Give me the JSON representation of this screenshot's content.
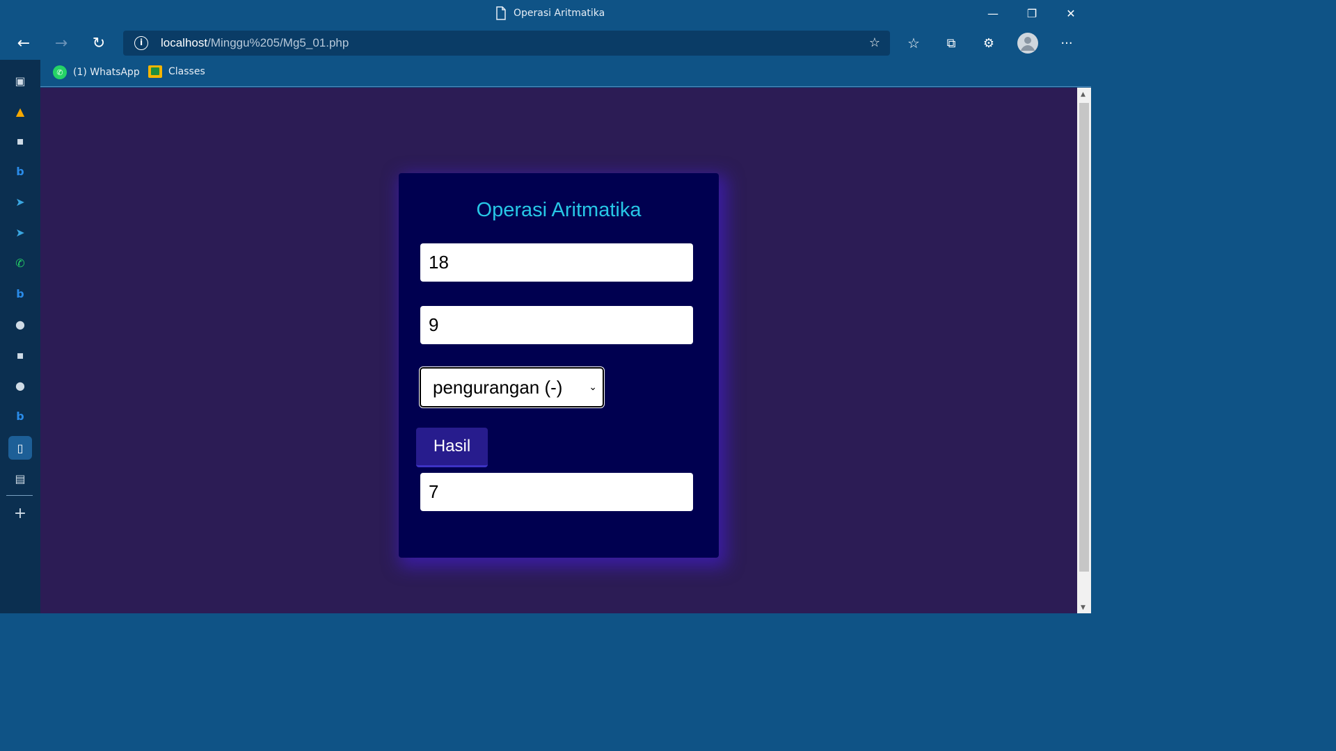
{
  "window": {
    "tab_title": "Operasi Aritmatika",
    "minimize": "—",
    "restore": "❐",
    "close": "✕"
  },
  "nav": {
    "back": "←",
    "forward": "→",
    "refresh": "↻",
    "info": "i",
    "url_host": "localhost",
    "url_path": "/Minggu%205/Mg5_01.php",
    "add_favorite": "☆",
    "favorites": "☆",
    "collections": "⧉",
    "extensions": "⚙",
    "menu": "···"
  },
  "bookmarks": [
    {
      "label": "(1) WhatsApp",
      "icon": "whatsapp-icon"
    },
    {
      "label": "Classes",
      "icon": "google-classroom-icon"
    }
  ],
  "sidebar": {
    "items": [
      {
        "icon": "tab-actions-icon",
        "glyph": "▣"
      },
      {
        "icon": "firebase-icon",
        "glyph": "▲"
      },
      {
        "icon": "contacts-icon",
        "glyph": "▪"
      },
      {
        "icon": "bing-icon",
        "glyph": "b"
      },
      {
        "icon": "telegram-icon",
        "glyph": "➤"
      },
      {
        "icon": "telegram-icon",
        "glyph": "➤"
      },
      {
        "icon": "whatsapp-icon",
        "glyph": "✆"
      },
      {
        "icon": "bing-icon",
        "glyph": "b"
      },
      {
        "icon": "github-icon",
        "glyph": "●"
      },
      {
        "icon": "contacts-icon",
        "glyph": "▪"
      },
      {
        "icon": "github-icon",
        "glyph": "●"
      },
      {
        "icon": "bing-icon",
        "glyph": "b"
      },
      {
        "icon": "document-icon",
        "glyph": "▯"
      },
      {
        "icon": "calendar-icon",
        "glyph": "▤"
      }
    ],
    "add": "+"
  },
  "form": {
    "title": "Operasi Aritmatika",
    "angka1": "18",
    "angka2": "9",
    "operation": "pengurangan (-)",
    "button": "Hasil",
    "result": "7"
  }
}
